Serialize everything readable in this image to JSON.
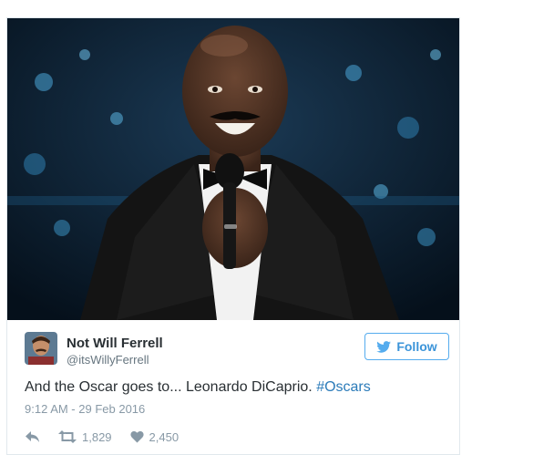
{
  "tweet": {
    "display_name": "Not Will Ferrell",
    "handle": "@itsWillyFerrell",
    "follow_label": "Follow",
    "text_main": "And the Oscar goes to... Leonardo DiCaprio. ",
    "hashtag": "#Oscars",
    "timestamp": "9:12 AM - 29 Feb 2016",
    "retweets": "1,829",
    "likes": "2,450"
  },
  "icons": {
    "reply": "reply-icon",
    "retweet": "retweet-icon",
    "like": "heart-icon",
    "follow": "twitter-bird-icon"
  },
  "colors": {
    "accent": "#55acee",
    "link": "#2b7bb9",
    "text": "#292f33",
    "muted": "#8899a6"
  }
}
